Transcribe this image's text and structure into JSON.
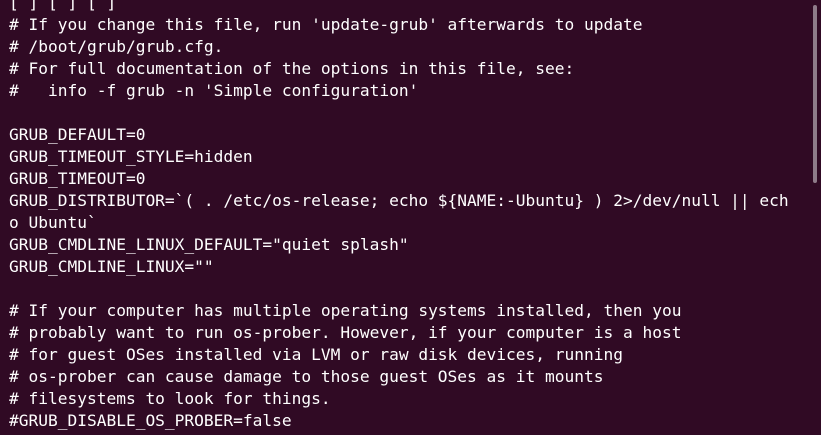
{
  "terminal": {
    "lines": [
      "[ ] [ ] [ ]",
      "# If you change this file, run 'update-grub' afterwards to update",
      "# /boot/grub/grub.cfg.",
      "# For full documentation of the options in this file, see:",
      "#   info -f grub -n 'Simple configuration'",
      "",
      "GRUB_DEFAULT=0",
      "GRUB_TIMEOUT_STYLE=hidden",
      "GRUB_TIMEOUT=0",
      "GRUB_DISTRIBUTOR=`( . /etc/os-release; echo ${NAME:-Ubuntu} ) 2>/dev/null || ech",
      "o Ubuntu`",
      "GRUB_CMDLINE_LINUX_DEFAULT=\"quiet splash\"",
      "GRUB_CMDLINE_LINUX=\"\"",
      "",
      "# If your computer has multiple operating systems installed, then you",
      "# probably want to run os-prober. However, if your computer is a host",
      "# for guest OSes installed via LVM or raw disk devices, running",
      "# os-prober can cause damage to those guest OSes as it mounts",
      "# filesystems to look for things.",
      "#GRUB_DISABLE_OS_PROBER=false"
    ]
  },
  "colors": {
    "background": "#300a24",
    "text": "#ffffff",
    "scrollbar": "#8e7b89"
  }
}
